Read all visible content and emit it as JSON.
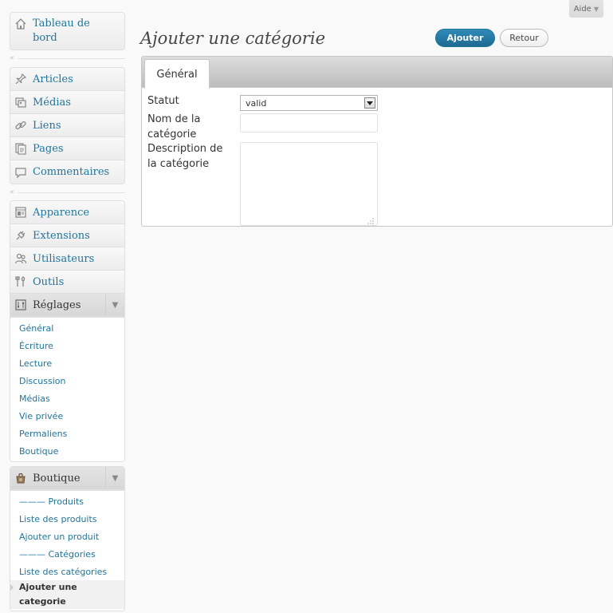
{
  "help": {
    "label": "Aide"
  },
  "sidebar": {
    "dashboard": {
      "label": "Tableau de bord"
    },
    "content": [
      {
        "label": "Articles",
        "icon": "pin-icon"
      },
      {
        "label": "Médias",
        "icon": "media-icon"
      },
      {
        "label": "Liens",
        "icon": "link-icon"
      },
      {
        "label": "Pages",
        "icon": "pages-icon"
      },
      {
        "label": "Commentaires",
        "icon": "comment-icon"
      }
    ],
    "admin": [
      {
        "label": "Apparence",
        "icon": "appearance-icon"
      },
      {
        "label": "Extensions",
        "icon": "plugin-icon"
      },
      {
        "label": "Utilisateurs",
        "icon": "users-icon"
      },
      {
        "label": "Outils",
        "icon": "tools-icon"
      },
      {
        "label": "Réglages",
        "icon": "settings-icon"
      }
    ],
    "settings_submenu": [
      "Général",
      "Écriture",
      "Lecture",
      "Discussion",
      "Médias",
      "Vie privée",
      "Permaliens",
      "Boutique"
    ],
    "shop": {
      "label": "Boutique",
      "submenu": [
        "——— Produits",
        "Liste des produits",
        "Ajouter un produit",
        "——— Catégories",
        "Liste des catégories"
      ],
      "current": "Ajouter une categorie"
    }
  },
  "main": {
    "title": "Ajouter une catégorie",
    "add_button": "Ajouter",
    "back_button": "Retour",
    "tab": "Général",
    "form": {
      "status_label": "Statut",
      "status_value": "valid",
      "name_label": "Nom de la catégorie",
      "name_value": "",
      "description_label": "Description de la catégorie",
      "description_value": ""
    }
  },
  "colors": {
    "link": "#21759b",
    "primary_button": "#21759b",
    "background": "#f9f9f9"
  }
}
